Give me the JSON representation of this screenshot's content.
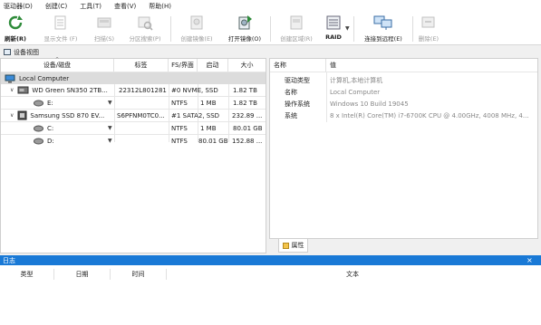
{
  "menu": [
    "驱动器(D)",
    "创建(C)",
    "工具(T)",
    "查看(V)",
    "帮助(H)"
  ],
  "toolbar": {
    "refresh": "刷新(R)",
    "show_files": "显示文件 (F)",
    "scan": "扫描(S)",
    "partition_search": "分区搜索(P)",
    "create_image": "创建镜像(E)",
    "open_image": "打开镜像(O)",
    "create_region": "创建区域(R)",
    "raid": "RAID",
    "connect_remote": "连接到远程(E)",
    "delete": "删除(E)"
  },
  "device_panel": {
    "title": "设备视图",
    "columns": [
      "设备/磁盘",
      "标签",
      "FS/界面",
      "启动",
      "大小"
    ],
    "rows": [
      {
        "name": "Local Computer",
        "label": "",
        "fs": "",
        "start": "",
        "size": "",
        "level": 0,
        "icon": "computer-icon",
        "selected": true
      },
      {
        "name": "WD Green SN350 2TB...",
        "label": "22312L801281",
        "fs": "#0 NVME, SSD",
        "start": "",
        "size": "1.82 TB",
        "level": 1,
        "icon": "ssd-icon"
      },
      {
        "name": "E:",
        "label": "",
        "fs": "NTFS",
        "start": "1 MB",
        "size": "1.82 TB",
        "level": 2,
        "icon": "volume-icon"
      },
      {
        "name": "Samsung SSD 870 EV...",
        "label": "S6PFNM0TC0...",
        "fs": "#1 SATA2, SSD",
        "start": "",
        "size": "232.89 ...",
        "level": 1,
        "icon": "ssd-icon"
      },
      {
        "name": "C:",
        "label": "",
        "fs": "NTFS",
        "start": "1 MB",
        "size": "80.01 GB",
        "level": 2,
        "icon": "volume-icon"
      },
      {
        "name": "D:",
        "label": "",
        "fs": "NTFS",
        "start": "80.01 GB",
        "size": "152.88 ...",
        "level": 2,
        "icon": "volume-icon"
      }
    ]
  },
  "properties": {
    "columns": [
      "名称",
      "值"
    ],
    "rows": [
      {
        "name": "驱动类型",
        "value": "计算机,本地计算机"
      },
      {
        "name": "名称",
        "value": "Local Computer"
      },
      {
        "name": "操作系统",
        "value": "Windows 10 Build 19045"
      },
      {
        "name": "系统",
        "value": "8 x Intel(R) Core(TM) i7-6700K CPU @ 4.00GHz, 4008 MHz, 4..."
      }
    ],
    "tab": "属性"
  },
  "log": {
    "title": "日志",
    "close": "×",
    "columns": [
      "类型",
      "日期",
      "时间",
      "文本"
    ]
  }
}
